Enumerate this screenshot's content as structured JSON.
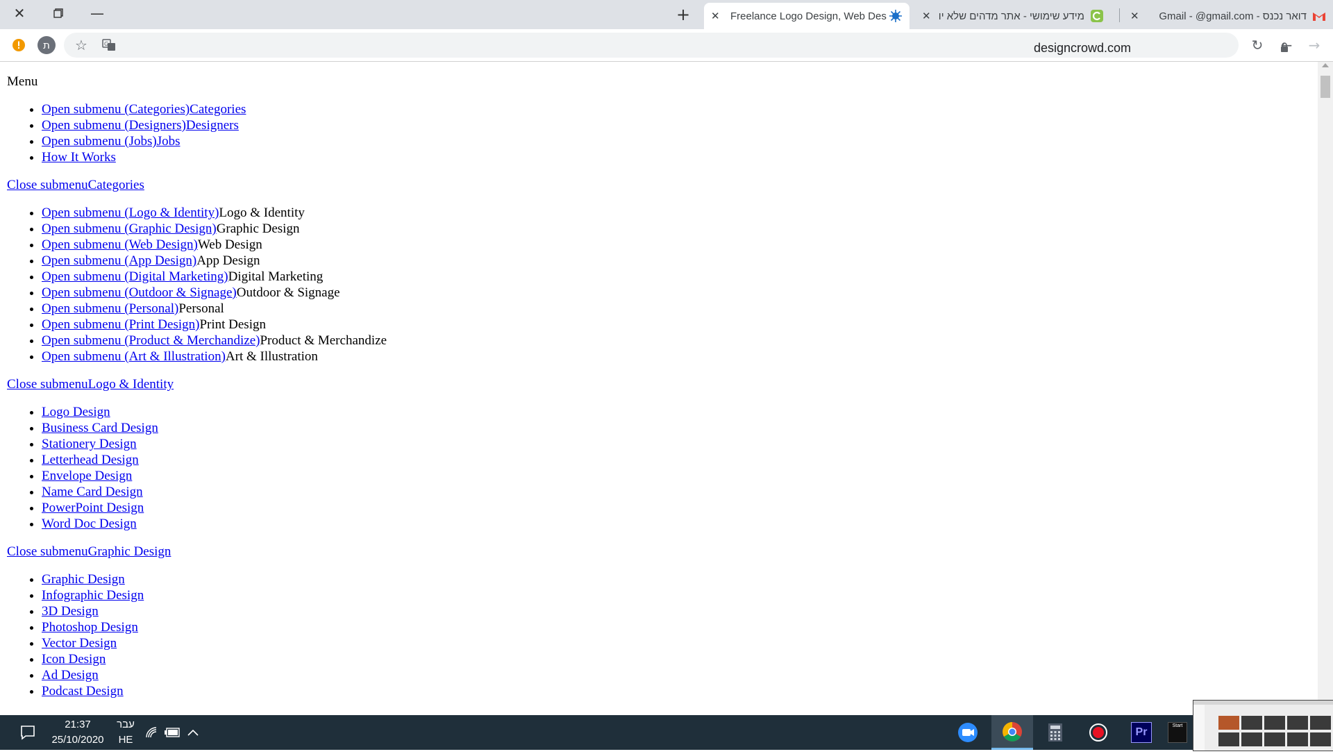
{
  "browser": {
    "tabs": [
      {
        "title": "Freelance Logo Design, Web Des",
        "active": true
      },
      {
        "title": "מידע שימושי - אתר מדהים שלא יו",
        "active": false
      },
      {
        "title": "דואר נכנס - Gmail - @gmail.com",
        "active": false
      }
    ],
    "profile_letter": "ת",
    "url": "designcrowd.com"
  },
  "page": {
    "menu_heading": "Menu",
    "main_menu": [
      {
        "link": "Open submenu (Categories)Categories"
      },
      {
        "link": "Open submenu (Designers)Designers"
      },
      {
        "link": "Open submenu (Jobs)Jobs"
      },
      {
        "link": "How It Works"
      }
    ],
    "categories_header": "Close submenuCategories",
    "categories": [
      {
        "link": "Open submenu (Logo & Identity)",
        "label": "Logo & Identity"
      },
      {
        "link": "Open submenu (Graphic Design)",
        "label": "Graphic Design"
      },
      {
        "link": "Open submenu (Web Design)",
        "label": "Web Design"
      },
      {
        "link": "Open submenu (App Design)",
        "label": "App Design"
      },
      {
        "link": "Open submenu (Digital Marketing)",
        "label": "Digital Marketing"
      },
      {
        "link": "Open submenu (Outdoor & Signage)",
        "label": "Outdoor & Signage"
      },
      {
        "link": "Open submenu (Personal)",
        "label": "Personal"
      },
      {
        "link": "Open submenu (Print Design)",
        "label": "Print Design"
      },
      {
        "link": "Open submenu (Product & Merchandize)",
        "label": "Product & Merchandize"
      },
      {
        "link": "Open submenu (Art & Illustration)",
        "label": "Art & Illustration"
      }
    ],
    "logo_header": "Close submenuLogo & Identity",
    "logo_items": [
      "Logo Design",
      "Business Card Design",
      "Stationery Design",
      "Letterhead Design",
      "Envelope Design",
      "Name Card Design",
      "PowerPoint Design",
      "Word Doc Design"
    ],
    "graphic_header": "Close submenuGraphic Design",
    "graphic_items": [
      "Graphic Design",
      "Infographic Design",
      "3D Design",
      "Photoshop Design",
      "Vector Design",
      "Icon Design",
      "Ad Design",
      "Podcast Design"
    ]
  },
  "taskbar": {
    "time": "21:37",
    "date": "25/10/2020",
    "language_top": "עבר",
    "language_bottom": "HE",
    "apps": [
      "zoom",
      "chrome",
      "calculator",
      "recorder",
      "premiere-pro",
      "start-app"
    ],
    "premiere_label": "Pr",
    "start_label": "Start"
  },
  "colors": {
    "link": "#0000ee",
    "tabbar_bg": "#dee1e6",
    "taskbar_bg": "#1f2f3a"
  }
}
